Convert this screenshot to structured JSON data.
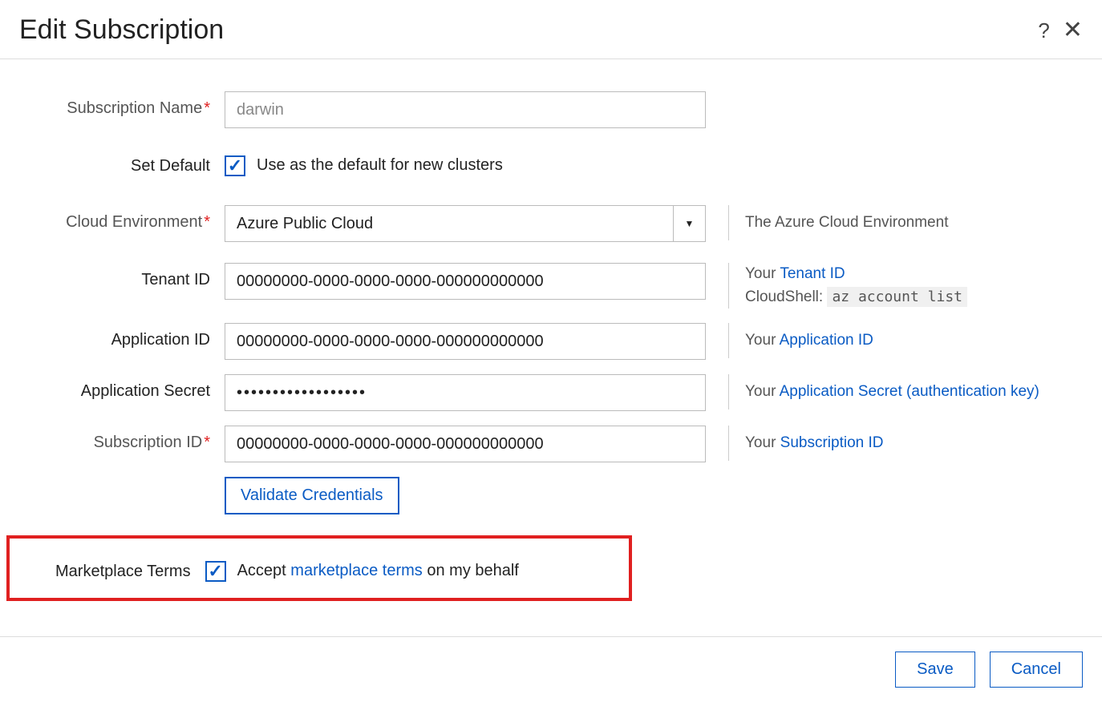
{
  "header": {
    "title": "Edit Subscription"
  },
  "labels": {
    "subscription_name": "Subscription Name",
    "set_default": "Set Default",
    "cloud_environment": "Cloud Environment",
    "tenant_id": "Tenant ID",
    "application_id": "Application ID",
    "application_secret": "Application Secret",
    "subscription_id": "Subscription ID",
    "marketplace_terms": "Marketplace Terms"
  },
  "fields": {
    "subscription_name_placeholder": "darwin",
    "subscription_name_value": "darwin",
    "set_default_label": "Use as the default for new clusters",
    "set_default_checked": true,
    "cloud_environment_value": "Azure Public Cloud",
    "tenant_id_value": "00000000-0000-0000-0000-000000000000",
    "application_id_value": "00000000-0000-0000-0000-000000000000",
    "application_secret_value": "••••••••••••••••••",
    "subscription_id_value": "00000000-0000-0000-0000-000000000000",
    "marketplace_accept_prefix": "Accept ",
    "marketplace_accept_link": "marketplace terms",
    "marketplace_accept_suffix": " on my behalf",
    "marketplace_checked": true
  },
  "hints": {
    "cloud_environment": "The Azure Cloud Environment",
    "tenant_id_prefix": "Your ",
    "tenant_id_link": "Tenant ID",
    "tenant_id_line2_prefix": "CloudShell: ",
    "tenant_id_line2_code": "az account list",
    "application_id_prefix": "Your ",
    "application_id_link": "Application ID",
    "application_secret_prefix": "Your ",
    "application_secret_link": "Application Secret (authentication key)",
    "subscription_id_prefix": "Your ",
    "subscription_id_link": "Subscription ID"
  },
  "buttons": {
    "validate": "Validate Credentials",
    "save": "Save",
    "cancel": "Cancel"
  }
}
